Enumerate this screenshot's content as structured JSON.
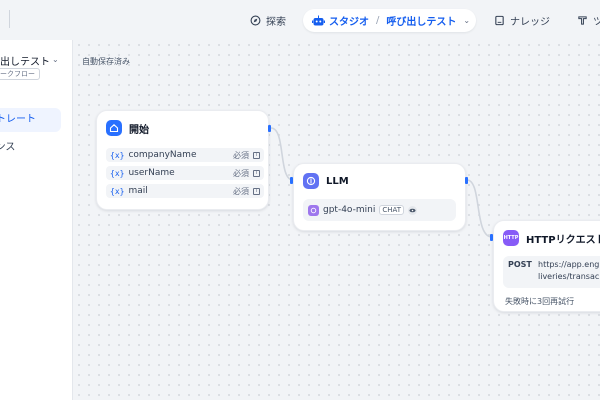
{
  "header": {
    "explore_label": "探索",
    "studio_label": "スタジオ",
    "app_name": "呼び出しテスト",
    "knowledge_label": "ナレッジ",
    "tools_label": "ツ"
  },
  "sidebar": {
    "app_title": "呼び出しテスト",
    "app_type": "ワークフロー",
    "items": [
      {
        "label": "オーケストレート"
      },
      {
        "label": "ログ&アナウンス"
      }
    ]
  },
  "canvas": {
    "autosave_status": "自動保存済み",
    "nodes": {
      "start": {
        "title": "開始",
        "variables": [
          {
            "name": "companyName",
            "required": "必須"
          },
          {
            "name": "userName",
            "required": "必須"
          },
          {
            "name": "mail",
            "required": "必須"
          }
        ]
      },
      "llm": {
        "title": "LLM",
        "model": "gpt-4o-mini",
        "mode_tag": "CHAT"
      },
      "http": {
        "title": "HTTPリクエスト",
        "icon_text": "HTTP",
        "method": "POST",
        "url_line1": "https://app.eng",
        "url_line2": "liveries/transac",
        "retry_text": "失敗時に3回再試行"
      }
    }
  },
  "icons": {
    "explore": "compass-icon",
    "studio": "robot-icon",
    "knowledge": "book-icon",
    "tools": "tool-icon",
    "start": "home-icon",
    "llm": "brain-icon",
    "model": "model-icon"
  },
  "colors": {
    "accent": "#155eef",
    "start_icon": "#2970ff",
    "llm_icon": "#6172f3",
    "http_icon": "#875bf7",
    "edge": "#d0d5dd"
  }
}
